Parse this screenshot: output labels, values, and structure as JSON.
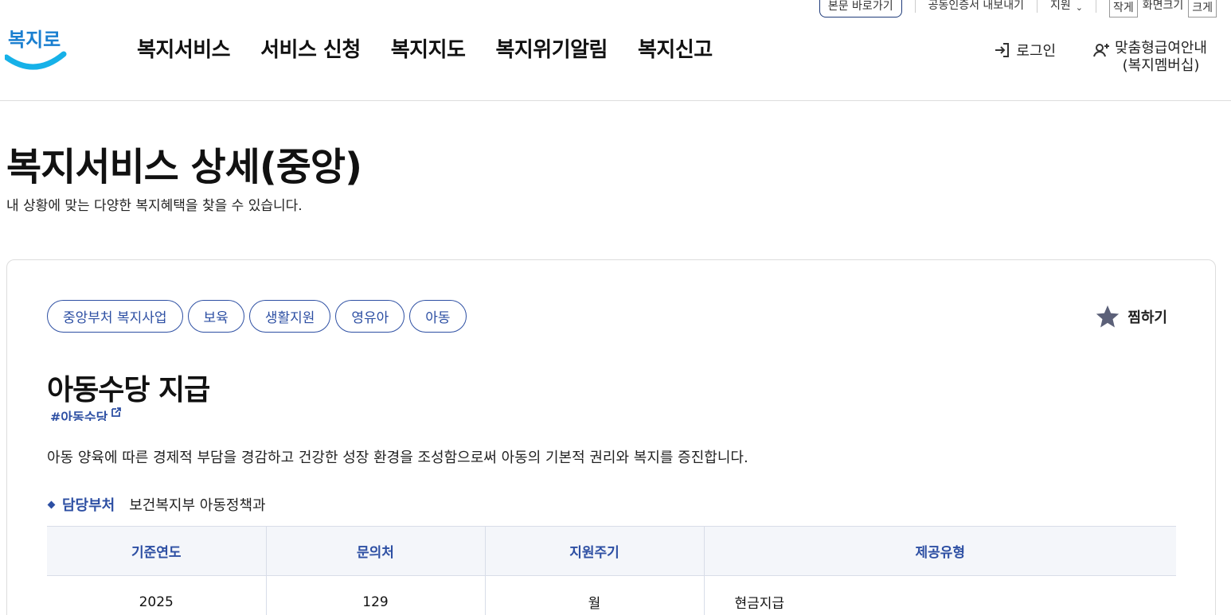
{
  "utility": {
    "skip_label": "본문 바로가기",
    "public_cert_label": "공동인증서 내보내기",
    "language_label": "지원",
    "small_label": "작게",
    "zoom_label": "화면크기",
    "large_label": "크게"
  },
  "header": {
    "logo_text": "복지로",
    "nav": [
      "복지서비스",
      "서비스 신청",
      "복지지도",
      "복지위기알림",
      "복지신고"
    ],
    "login_label": "로그인",
    "member_label_line1": "맞춤형급여안내",
    "member_label_line2": "(복지멤버십)"
  },
  "page": {
    "title": "복지서비스 상세(중앙)",
    "subtitle": "내 상황에 맞는 다양한 복지혜택을 찾을 수 있습니다."
  },
  "service": {
    "tags": [
      "중앙부처 복지사업",
      "보육",
      "생활지원",
      "영유아",
      "아동"
    ],
    "favorite_label": "찜하기",
    "title": "아동수당 지급",
    "hashtag": "#아동수당",
    "description": "아동 양육에 따른 경제적 부담을 경감하고 건강한 성장 환경을 조성함으로써 아동의 기본적 권리와 복지를 증진합니다.",
    "dept_label": "담당부처",
    "dept_value": "보건복지부 아동정책과",
    "table": {
      "headers": [
        "기준연도",
        "문의처",
        "지원주기",
        "제공유형"
      ],
      "row": [
        "2025",
        "129",
        "월",
        "현금지급"
      ]
    }
  },
  "colors": {
    "accent": "#2d4fa3",
    "logo_blue": "#16b1e8",
    "table_header_bg": "#f4f6fa"
  }
}
